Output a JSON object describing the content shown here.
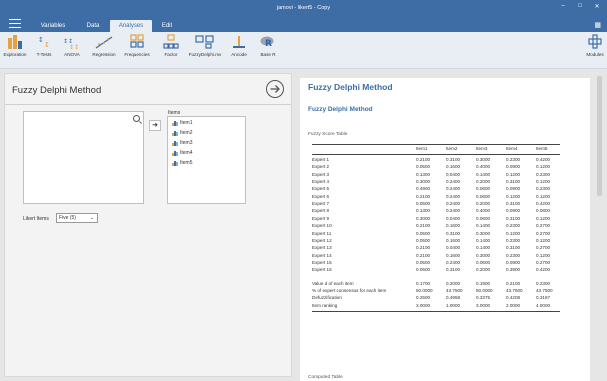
{
  "window": {
    "title": "jamovi - likert5 - Copy",
    "controls": [
      "–",
      "□",
      "✕"
    ]
  },
  "menu": {
    "tabs": [
      "Variables",
      "Data",
      "Analyses",
      "Edit"
    ],
    "active_tab": "Analyses",
    "right_icon": "grid-menu-icon"
  },
  "ribbon": {
    "buttons": [
      {
        "label": "Exploration",
        "icon": "bar-chart-icon"
      },
      {
        "label": "T-Tests",
        "icon": "t-test-icon"
      },
      {
        "label": "ANOVA",
        "icon": "anova-icon"
      },
      {
        "label": "Regression",
        "icon": "regression-icon"
      },
      {
        "label": "Frequencies",
        "icon": "frequencies-icon"
      },
      {
        "label": "Factor",
        "icon": "factor-icon"
      },
      {
        "label": "FuzzyDelphi.mv",
        "icon": "fuzzy-delphi-icon"
      },
      {
        "label": "Ancode",
        "icon": "ancode-icon"
      },
      {
        "label": "Base R",
        "icon": "r-logo-icon"
      }
    ],
    "modules_label": "Modules"
  },
  "options": {
    "title": "Fuzzy Delphi Method",
    "items_label": "Items",
    "items": [
      "Item1",
      "Item2",
      "Item3",
      "Item4",
      "Item5"
    ],
    "likert_label": "Likert Items",
    "likert_value": "Five (5)"
  },
  "results": {
    "heading": "Fuzzy Delphi Method",
    "subheading": "Fuzzy Delphi Method",
    "table_caption": "Fuzzy Score Table",
    "computed_caption": "Computed Table",
    "table": {
      "columns": [
        "",
        "Item1",
        "Item2",
        "Item3",
        "Item4",
        "Item5"
      ],
      "rows": [
        [
          "Expert 1",
          "0.2100",
          "0.3100",
          "0.3000",
          "0.2300",
          "0.4200"
        ],
        [
          "Expert 2",
          "0.0500",
          "0.1600",
          "0.4000",
          "0.0900",
          "0.1200"
        ],
        [
          "Expert 3",
          "0.1300",
          "0.0400",
          "0.1400",
          "0.1200",
          "0.2300"
        ],
        [
          "Expert 4",
          "0.3000",
          "0.2400",
          "0.2000",
          "0.3100",
          "0.1200"
        ],
        [
          "Expert 5",
          "0.4900",
          "0.2400",
          "0.0600",
          "0.0900",
          "0.2300"
        ],
        [
          "Expert 6",
          "0.2100",
          "0.2400",
          "0.0600",
          "0.1200",
          "0.1200"
        ],
        [
          "Expert 7",
          "0.0500",
          "0.2400",
          "0.2000",
          "0.3100",
          "0.4200"
        ],
        [
          "Expert 8",
          "0.1300",
          "0.2400",
          "0.4000",
          "0.0900",
          "0.0800"
        ],
        [
          "Expert 9",
          "0.3000",
          "0.0400",
          "0.0600",
          "0.3100",
          "0.1200"
        ],
        [
          "Expert 10",
          "0.2100",
          "0.1600",
          "0.1400",
          "0.2300",
          "0.2700"
        ],
        [
          "Expert 11",
          "0.0500",
          "0.3100",
          "0.3000",
          "0.1200",
          "0.2700"
        ],
        [
          "Expert 12",
          "0.0500",
          "0.1600",
          "0.1400",
          "0.2300",
          "0.1200"
        ],
        [
          "Expert 13",
          "0.2100",
          "0.0400",
          "0.1400",
          "0.3100",
          "0.2700"
        ],
        [
          "Expert 14",
          "0.2100",
          "0.1600",
          "0.3000",
          "0.2300",
          "0.1200"
        ],
        [
          "Expert 15",
          "0.0500",
          "0.2400",
          "0.0600",
          "0.0900",
          "0.2700"
        ],
        [
          "Expert 16",
          "0.0500",
          "0.3100",
          "0.2000",
          "0.3900",
          "0.4200"
        ]
      ],
      "summary": [
        [
          "Value d of each item",
          "0.1700",
          "0.2000",
          "0.1900",
          "0.2100",
          "0.2300"
        ],
        [
          "% of expert consensus for each item",
          "50.0000",
          "43.7500",
          "50.0000",
          "43.7500",
          "43.7500"
        ],
        [
          "Defuzzification",
          "0.2500",
          "0.4958",
          "0.3375",
          "0.4208",
          "0.3167"
        ],
        [
          "Item ranking",
          "3.0000",
          "1.0000",
          "3.0000",
          "2.0000",
          "4.0000"
        ]
      ]
    }
  },
  "colors": {
    "header": "#3e6da5",
    "accent": "#3e6da5",
    "ribbon_bg": "#e9eef4"
  }
}
